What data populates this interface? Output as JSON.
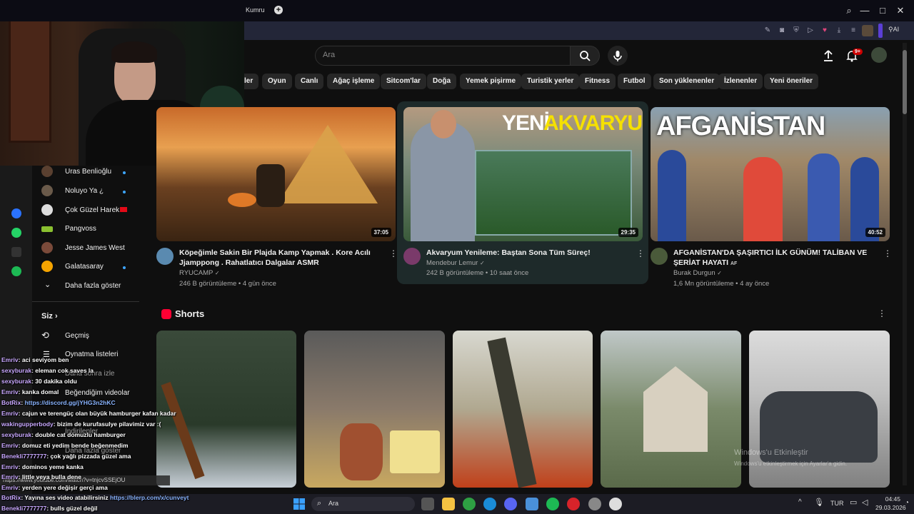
{
  "browser": {
    "tab_title": "Kumru",
    "new_tab": "+",
    "ai_button": "AI",
    "window_controls": [
      "⌕",
      "—",
      "□",
      "✕"
    ]
  },
  "youtube": {
    "search_placeholder": "Ara",
    "notification_count": "9+",
    "chips": [
      "ler",
      "Oyun",
      "Canlı",
      "Ağaç işleme",
      "Sitcom'lar",
      "Doğa",
      "Yemek pişirme",
      "Turistik yerler",
      "Fitness",
      "Futbol",
      "Son yüklenenler",
      "İzlenenler",
      "Yeni öneriler"
    ],
    "videos": [
      {
        "title_line1": "Köpeğimle Sakin Bir Plajda Kamp Yapmak . Kore Acılı",
        "title_line2": "Jjamppong . Rahatlatıcı Dalgalar ASMR",
        "channel": "RYUCAMP",
        "meta": "246 B görüntüleme • 4 gün önce",
        "duration": "37:05"
      },
      {
        "title_line1": "Akvaryum Yenileme: Baştan Sona Tüm Süreç!",
        "title_line2": "",
        "channel": "Mendebur Lemur",
        "meta": "242 B görüntüleme • 10 saat önce",
        "duration": "29:35",
        "thumb_text_1": "YENİ",
        "thumb_text_2": "AKVARYUM"
      },
      {
        "title_line1": "AFGANİSTAN'DA ŞAŞIRTICI İLK GÜNÜM! TALİBAN VE",
        "title_line2": "ŞERİAT HAYATI",
        "channel": "Burak Durgun",
        "meta": "1,6 Mn görüntüleme • 4 ay önce",
        "duration": "40:52",
        "thumb_text_1": "AFGANİSTAN",
        "badge": "AF"
      }
    ],
    "shorts_title": "Shorts",
    "sidebar": {
      "subs": [
        "Uras Benlioğlu",
        "Noluyo Ya ¿",
        "Çok Güzel Harek...",
        "Pangvoss",
        "Jesse James West",
        "Galatasaray"
      ],
      "more": "Daha fazla göster",
      "you": "Siz",
      "history": "Geçmiş",
      "playlists": "Oynatma listeleri",
      "watch_later": "Daha sonra izle",
      "liked": "Beğendiğim videolar",
      "downloads": "İndirilenler",
      "more2": "Daha fazla göster"
    },
    "status_url": "https://www.youtube.com/watch?v=tnjcvSSEjOU",
    "watermark_1": "Windows'u Etkinleştir",
    "watermark_2": "Windows'u etkinleştirmek için Ayarlar'a gidin."
  },
  "chat": [
    {
      "user": "Emriv",
      "text": ": aci seviyom ben"
    },
    {
      "user": "sexyburak",
      "text": ": eleman cok saves la"
    },
    {
      "user": "sexyburak",
      "text": ": 30 dakika oldu"
    },
    {
      "user": "Emriv",
      "text": ": kanka domal"
    },
    {
      "user": "BotRix",
      "text": ": ",
      "link": "https://discord.gg/jYHG3n2hKC"
    },
    {
      "user": "Emriv",
      "text": ": cajun ve terengüç olan büyük hamburger kafan kadar"
    },
    {
      "user": "wakingupperbody",
      "text": ": bizim de kurufasulye pilavimiz var :("
    },
    {
      "user": "sexyburak",
      "text": ": double cat domuzlu hamburger"
    },
    {
      "user": "Emriv",
      "text": ": domuz eti yedim bende beğenmedim"
    },
    {
      "user": "Benekli7777777",
      "text": ": çok yağlı pizzada güzel ama"
    },
    {
      "user": "Emriv",
      "text": ": dominos yeme kanka"
    },
    {
      "user": "Emriv",
      "text": ": little veya bulla dene"
    },
    {
      "user": "Emriv",
      "text": ": yerden yere değişir gerçi ama"
    },
    {
      "user": "BotRix",
      "text": ": Yayına ses video atabilirsiniz ",
      "link": "https://blerp.com/x/cunveyt"
    },
    {
      "user": "Benekli7777777",
      "text": ": bulls güzel değil"
    }
  ],
  "taskbar": {
    "search": "Ara",
    "lang": "TUR",
    "time": "04:45",
    "date": "29.03.2026"
  },
  "colors": {
    "accent_red": "#ff0033",
    "chip_bg": "#272727",
    "highlight_card": "#1e2a2a"
  }
}
